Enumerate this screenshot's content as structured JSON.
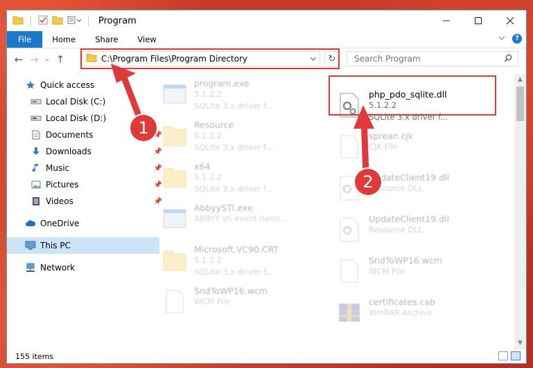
{
  "window": {
    "title": "Program",
    "controls": [
      "minimize",
      "maximize",
      "close"
    ]
  },
  "ribbon": {
    "tabs": [
      {
        "label": "File",
        "active": true
      },
      {
        "label": "Home"
      },
      {
        "label": "Share"
      },
      {
        "label": "View"
      }
    ]
  },
  "address_bar": {
    "path": "C:\\Program Files\\Program Directory"
  },
  "search": {
    "placeholder": "Search Program"
  },
  "sidebar": {
    "items": [
      {
        "label": "Quick access",
        "icon": "star-icon"
      },
      {
        "label": "Local Disk (C:)",
        "icon": "drive-icon"
      },
      {
        "label": "Local Disk (D:)",
        "icon": "drive-icon"
      },
      {
        "label": "Documents",
        "icon": "documents-icon",
        "pinned": true
      },
      {
        "label": "Downloads",
        "icon": "download-icon",
        "pinned": true
      },
      {
        "label": "Music",
        "icon": "music-icon",
        "pinned": true
      },
      {
        "label": "Pictures",
        "icon": "pictures-icon",
        "pinned": true
      },
      {
        "label": "Videos",
        "icon": "videos-icon",
        "pinned": true
      },
      {
        "label": "OneDrive",
        "icon": "cloud-icon"
      },
      {
        "label": "This PC",
        "icon": "pc-icon",
        "selected": true
      },
      {
        "label": "Network",
        "icon": "network-icon"
      }
    ]
  },
  "files": {
    "highlighted": {
      "name": "php_pdo_sqlite.dll",
      "line1": "5.1.2.2",
      "line2": "SQLite 3.x driver f..."
    },
    "left": [
      {
        "name": "program.exe",
        "line1": "5.1.2.2",
        "line2": "SQLite 3.x driver f...",
        "icon": "app-icon"
      },
      {
        "name": "Resource",
        "line1": "5.1.2.2",
        "line2": "SQLite 3.x driver f...",
        "icon": "folder-icon"
      },
      {
        "name": "x64",
        "line1": "5.1.2.2",
        "line2": "SQLite 3.x driver f...",
        "icon": "folder-icon"
      },
      {
        "name": "AbbyySTI.exe",
        "line1": "ABBYY sti event hand...",
        "line2": "",
        "icon": "app-icon"
      },
      {
        "name": "Microsoft.VC90.CRT",
        "line1": "5.1.2.2",
        "line2": "SQLite 3.x driver f...",
        "icon": "folder-icon"
      },
      {
        "name": "SndToWP16.wcm",
        "line1": "WCM File",
        "line2": "",
        "icon": "file-icon"
      }
    ],
    "right": [
      {
        "name": "sprean.cjk",
        "line1": "CJK File",
        "line2": "",
        "icon": "file-icon"
      },
      {
        "name": "UpdateClient19.dll",
        "line1": "Resource DLL",
        "line2": "",
        "icon": "dll-icon"
      },
      {
        "name": "UpdateClient19.dll",
        "line1": "Resource DLL",
        "line2": "",
        "icon": "dll-icon"
      },
      {
        "name": "SndToWP16.wcm",
        "line1": "WCM File",
        "line2": "",
        "icon": "file-icon"
      },
      {
        "name": "certificates.cab",
        "line1": "WinRAR Archive",
        "line2": "",
        "icon": "archive-icon"
      }
    ]
  },
  "status": {
    "item_count": "155 items"
  },
  "annotations": {
    "step1": "1",
    "step2": "2",
    "color": "#e0393a"
  }
}
